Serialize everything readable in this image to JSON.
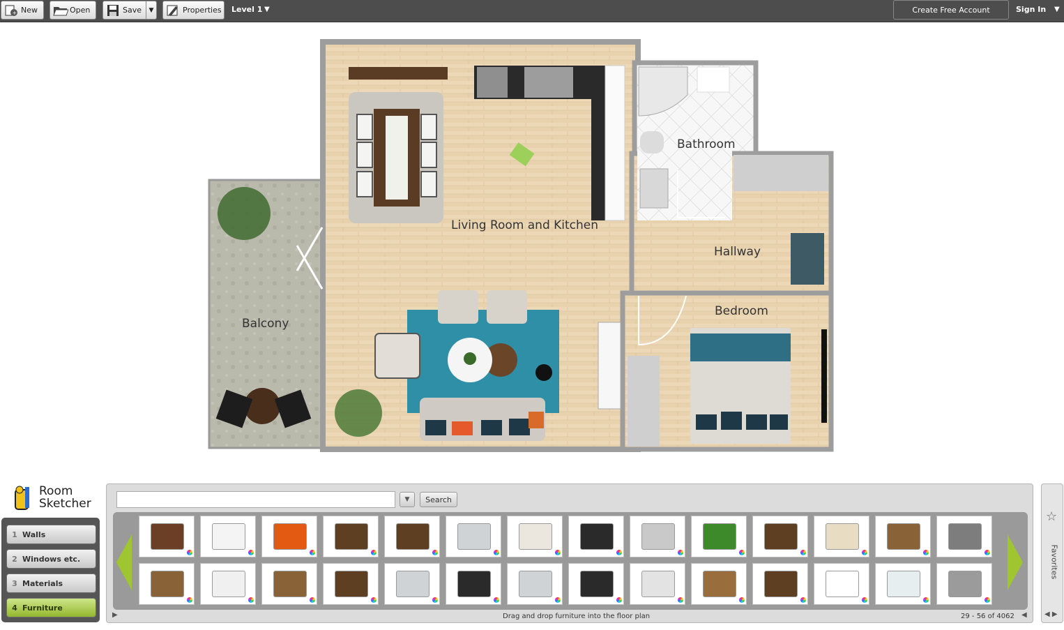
{
  "toolbar": {
    "new_label": "New",
    "open_label": "Open",
    "save_label": "Save",
    "properties_label": "Properties",
    "level_label": "Level 1",
    "create_account_label": "Create Free Account",
    "sign_in_label": "Sign In"
  },
  "rooms": {
    "living": "Living Room and Kitchen",
    "bathroom": "Bathroom",
    "hallway": "Hallway",
    "bedroom": "Bedroom",
    "balcony": "Balcony"
  },
  "logo": {
    "line1": "Room",
    "line2": "Sketcher"
  },
  "steps": [
    {
      "num": "1",
      "label": "Walls"
    },
    {
      "num": "2",
      "label": "Windows etc."
    },
    {
      "num": "3",
      "label": "Materials"
    },
    {
      "num": "4",
      "label": "Furniture"
    }
  ],
  "library": {
    "search_placeholder": "",
    "search_button": "Search",
    "hint": "Drag and drop furniture into the floor plan",
    "count": "29 - 56 of 4062"
  },
  "favorites": {
    "label": "Favorites"
  },
  "colors": {
    "accent_green": "#9fc531",
    "topbar": "#4d4d4d",
    "floor": "#e6cfaa",
    "rug": "#2e8fa6"
  }
}
